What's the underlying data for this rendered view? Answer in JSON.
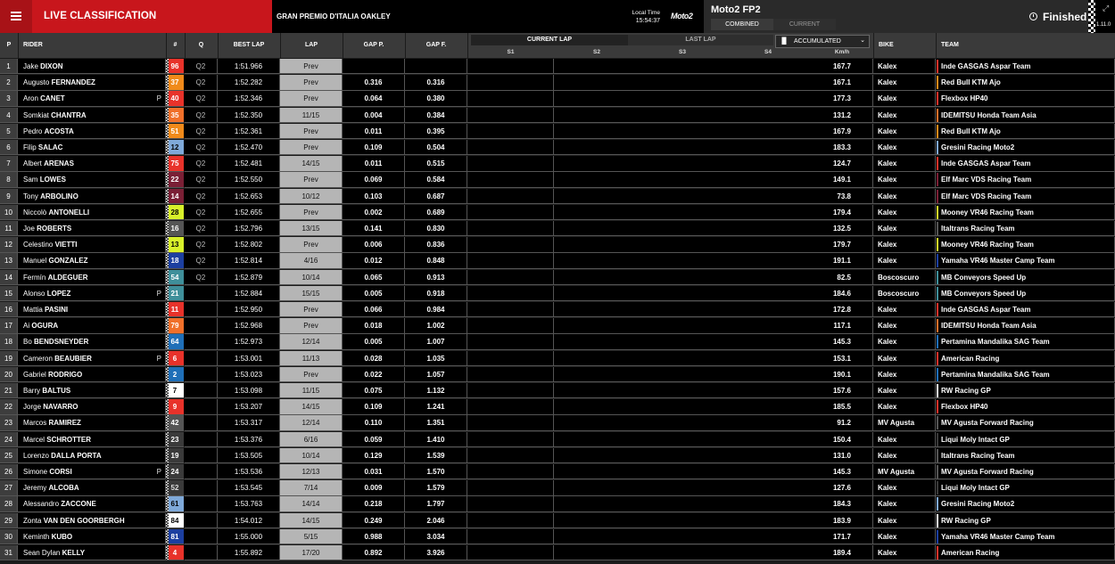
{
  "topbar": {
    "title": "LIVE CLASSIFICATION",
    "event": "GRAN PREMIO D'ITALIA OAKLEY",
    "local_time_label": "Local Time",
    "local_time": "15:54:37",
    "logo_text": "Moto2",
    "session": "Moto2 FP2",
    "tab_combined": "COMBINED",
    "tab_current": "CURRENT",
    "status": "Finished",
    "version": "1.11.0"
  },
  "headers": {
    "pos": "P",
    "rider": "RIDER",
    "num": "#",
    "q": "Q",
    "best": "BEST LAP",
    "lap": "LAP",
    "gapp": "GAP P.",
    "gapf": "GAP F.",
    "current_lap": "CURRENT LAP",
    "last_lap": "LAST LAP",
    "accumulated": "ACCUMULATED",
    "s1": "S1",
    "s2": "S2",
    "s3": "S3",
    "s4": "S4",
    "kmh": "Km/h",
    "bike": "BIKE",
    "team": "TEAM"
  },
  "rows": [
    {
      "pos": "1",
      "first": "Jake",
      "last": "DIXON",
      "pit": "",
      "num": "96",
      "num_bg": "#e8322a",
      "num_fg": "#fff",
      "q": "Q2",
      "best": "1:51.966",
      "lap": "Prev",
      "gapp": "",
      "gapf": "",
      "kmh": "167.7",
      "bike": "Kalex",
      "team": "Inde GASGAS Aspar Team",
      "team_color": "#e8322a"
    },
    {
      "pos": "2",
      "first": "Augusto",
      "last": "FERNANDEZ",
      "pit": "",
      "num": "37",
      "num_bg": "#f08a1a",
      "num_fg": "#fff",
      "q": "Q2",
      "best": "1:52.282",
      "lap": "Prev",
      "gapp": "0.316",
      "gapf": "0.316",
      "kmh": "167.1",
      "bike": "Kalex",
      "team": "Red Bull KTM Ajo",
      "team_color": "#f08a1a"
    },
    {
      "pos": "3",
      "first": "Aron",
      "last": "CANET",
      "pit": "P",
      "num": "40",
      "num_bg": "#e8322a",
      "num_fg": "#fff",
      "q": "Q2",
      "best": "1:52.346",
      "lap": "Prev",
      "gapp": "0.064",
      "gapf": "0.380",
      "kmh": "177.3",
      "bike": "Kalex",
      "team": "Flexbox HP40",
      "team_color": "#e8322a"
    },
    {
      "pos": "4",
      "first": "Somkiat",
      "last": "CHANTRA",
      "pit": "",
      "num": "35",
      "num_bg": "#f0702a",
      "num_fg": "#fff",
      "q": "Q2",
      "best": "1:52.350",
      "lap": "11/15",
      "gapp": "0.004",
      "gapf": "0.384",
      "kmh": "131.2",
      "bike": "Kalex",
      "team": "IDEMITSU Honda Team Asia",
      "team_color": "#f0702a"
    },
    {
      "pos": "5",
      "first": "Pedro",
      "last": "ACOSTA",
      "pit": "",
      "num": "51",
      "num_bg": "#f08a1a",
      "num_fg": "#fff",
      "q": "Q2",
      "best": "1:52.361",
      "lap": "Prev",
      "gapp": "0.011",
      "gapf": "0.395",
      "kmh": "167.9",
      "bike": "Kalex",
      "team": "Red Bull KTM Ajo",
      "team_color": "#f08a1a"
    },
    {
      "pos": "6",
      "first": "Filip",
      "last": "SALAC",
      "pit": "",
      "num": "12",
      "num_bg": "#7fa9d9",
      "num_fg": "#000",
      "q": "Q2",
      "best": "1:52.470",
      "lap": "Prev",
      "gapp": "0.109",
      "gapf": "0.504",
      "kmh": "183.3",
      "bike": "Kalex",
      "team": "Gresini Racing Moto2",
      "team_color": "#7fa9d9"
    },
    {
      "pos": "7",
      "first": "Albert",
      "last": "ARENAS",
      "pit": "",
      "num": "75",
      "num_bg": "#e8322a",
      "num_fg": "#fff",
      "q": "Q2",
      "best": "1:52.481",
      "lap": "14/15",
      "gapp": "0.011",
      "gapf": "0.515",
      "kmh": "124.7",
      "bike": "Kalex",
      "team": "Inde GASGAS Aspar Team",
      "team_color": "#e8322a"
    },
    {
      "pos": "8",
      "first": "Sam",
      "last": "LOWES",
      "pit": "",
      "num": "22",
      "num_bg": "#7a1f35",
      "num_fg": "#fff",
      "q": "Q2",
      "best": "1:52.550",
      "lap": "Prev",
      "gapp": "0.069",
      "gapf": "0.584",
      "kmh": "149.1",
      "bike": "Kalex",
      "team": "Elf Marc VDS Racing Team",
      "team_color": "#7a1f35"
    },
    {
      "pos": "9",
      "first": "Tony",
      "last": "ARBOLINO",
      "pit": "",
      "num": "14",
      "num_bg": "#7a1f35",
      "num_fg": "#fff",
      "q": "Q2",
      "best": "1:52.653",
      "lap": "10/12",
      "gapp": "0.103",
      "gapf": "0.687",
      "kmh": "73.8",
      "bike": "Kalex",
      "team": "Elf Marc VDS Racing Team",
      "team_color": "#7a1f35"
    },
    {
      "pos": "10",
      "first": "Niccolò",
      "last": "ANTONELLI",
      "pit": "",
      "num": "28",
      "num_bg": "#d8f02a",
      "num_fg": "#000",
      "q": "Q2",
      "best": "1:52.655",
      "lap": "Prev",
      "gapp": "0.002",
      "gapf": "0.689",
      "kmh": "179.4",
      "bike": "Kalex",
      "team": "Mooney VR46 Racing Team",
      "team_color": "#d8f02a"
    },
    {
      "pos": "11",
      "first": "Joe",
      "last": "ROBERTS",
      "pit": "",
      "num": "16",
      "num_bg": "#555",
      "num_fg": "#fff",
      "q": "Q2",
      "best": "1:52.796",
      "lap": "13/15",
      "gapp": "0.141",
      "gapf": "0.830",
      "kmh": "132.5",
      "bike": "Kalex",
      "team": "Italtrans Racing Team",
      "team_color": "#555"
    },
    {
      "pos": "12",
      "first": "Celestino",
      "last": "VIETTI",
      "pit": "",
      "num": "13",
      "num_bg": "#d8f02a",
      "num_fg": "#000",
      "q": "Q2",
      "best": "1:52.802",
      "lap": "Prev",
      "gapp": "0.006",
      "gapf": "0.836",
      "kmh": "179.7",
      "bike": "Kalex",
      "team": "Mooney VR46 Racing Team",
      "team_color": "#d8f02a"
    },
    {
      "pos": "13",
      "first": "Manuel",
      "last": "GONZALEZ",
      "pit": "",
      "num": "18",
      "num_bg": "#1c3fa0",
      "num_fg": "#fff",
      "q": "Q2",
      "best": "1:52.814",
      "lap": "4/16",
      "gapp": "0.012",
      "gapf": "0.848",
      "kmh": "191.1",
      "bike": "Kalex",
      "team": "Yamaha VR46 Master Camp Team",
      "team_color": "#1c3fa0"
    },
    {
      "pos": "14",
      "first": "Fermín",
      "last": "ALDEGUER",
      "pit": "",
      "num": "54",
      "num_bg": "#3f8f9a",
      "num_fg": "#fff",
      "q": "Q2",
      "best": "1:52.879",
      "lap": "10/14",
      "gapp": "0.065",
      "gapf": "0.913",
      "kmh": "82.5",
      "bike": "Boscoscuro",
      "team": "MB Conveyors Speed Up",
      "team_color": "#3f8f9a"
    },
    {
      "pos": "15",
      "first": "Alonso",
      "last": "LOPEZ",
      "pit": "P",
      "num": "21",
      "num_bg": "#3f8f9a",
      "num_fg": "#fff",
      "q": "",
      "best": "1:52.884",
      "lap": "15/15",
      "gapp": "0.005",
      "gapf": "0.918",
      "kmh": "184.6",
      "bike": "Boscoscuro",
      "team": "MB Conveyors Speed Up",
      "team_color": "#3f8f9a"
    },
    {
      "pos": "16",
      "first": "Mattia",
      "last": "PASINI",
      "pit": "",
      "num": "11",
      "num_bg": "#e8322a",
      "num_fg": "#fff",
      "q": "",
      "best": "1:52.950",
      "lap": "Prev",
      "gapp": "0.066",
      "gapf": "0.984",
      "kmh": "172.8",
      "bike": "Kalex",
      "team": "Inde GASGAS Aspar Team",
      "team_color": "#e8322a"
    },
    {
      "pos": "17",
      "first": "Ai",
      "last": "OGURA",
      "pit": "",
      "num": "79",
      "num_bg": "#f0702a",
      "num_fg": "#fff",
      "q": "",
      "best": "1:52.968",
      "lap": "Prev",
      "gapp": "0.018",
      "gapf": "1.002",
      "kmh": "117.1",
      "bike": "Kalex",
      "team": "IDEMITSU Honda Team Asia",
      "team_color": "#f0702a"
    },
    {
      "pos": "18",
      "first": "Bo",
      "last": "BENDSNEYDER",
      "pit": "",
      "num": "64",
      "num_bg": "#1f6fb8",
      "num_fg": "#fff",
      "q": "",
      "best": "1:52.973",
      "lap": "12/14",
      "gapp": "0.005",
      "gapf": "1.007",
      "kmh": "145.3",
      "bike": "Kalex",
      "team": "Pertamina Mandalika SAG Team",
      "team_color": "#1f6fb8"
    },
    {
      "pos": "19",
      "first": "Cameron",
      "last": "BEAUBIER",
      "pit": "P",
      "num": "6",
      "num_bg": "#e8322a",
      "num_fg": "#fff",
      "q": "",
      "best": "1:53.001",
      "lap": "11/13",
      "gapp": "0.028",
      "gapf": "1.035",
      "kmh": "153.1",
      "bike": "Kalex",
      "team": "American Racing",
      "team_color": "#e8322a"
    },
    {
      "pos": "20",
      "first": "Gabriel",
      "last": "RODRIGO",
      "pit": "",
      "num": "2",
      "num_bg": "#1f6fb8",
      "num_fg": "#fff",
      "q": "",
      "best": "1:53.023",
      "lap": "Prev",
      "gapp": "0.022",
      "gapf": "1.057",
      "kmh": "190.1",
      "bike": "Kalex",
      "team": "Pertamina Mandalika SAG Team",
      "team_color": "#1f6fb8"
    },
    {
      "pos": "21",
      "first": "Barry",
      "last": "BALTUS",
      "pit": "",
      "num": "7",
      "num_bg": "#ffffff",
      "num_fg": "#000",
      "q": "",
      "best": "1:53.098",
      "lap": "11/15",
      "gapp": "0.075",
      "gapf": "1.132",
      "kmh": "157.6",
      "bike": "Kalex",
      "team": "RW Racing GP",
      "team_color": "#ffffff"
    },
    {
      "pos": "22",
      "first": "Jorge",
      "last": "NAVARRO",
      "pit": "",
      "num": "9",
      "num_bg": "#e8322a",
      "num_fg": "#fff",
      "q": "",
      "best": "1:53.207",
      "lap": "14/15",
      "gapp": "0.109",
      "gapf": "1.241",
      "kmh": "185.5",
      "bike": "Kalex",
      "team": "Flexbox HP40",
      "team_color": "#e8322a"
    },
    {
      "pos": "23",
      "first": "Marcos",
      "last": "RAMIREZ",
      "pit": "",
      "num": "42",
      "num_bg": "#555",
      "num_fg": "#fff",
      "q": "",
      "best": "1:53.317",
      "lap": "12/14",
      "gapp": "0.110",
      "gapf": "1.351",
      "kmh": "91.2",
      "bike": "MV Agusta",
      "team": "MV Agusta Forward Racing",
      "team_color": "#555"
    },
    {
      "pos": "24",
      "first": "Marcel",
      "last": "SCHROTTER",
      "pit": "",
      "num": "23",
      "num_bg": "#3a3a3a",
      "num_fg": "#fff",
      "q": "",
      "best": "1:53.376",
      "lap": "6/16",
      "gapp": "0.059",
      "gapf": "1.410",
      "kmh": "150.4",
      "bike": "Kalex",
      "team": "Liqui Moly Intact GP",
      "team_color": "#3a3a3a"
    },
    {
      "pos": "25",
      "first": "Lorenzo",
      "last": "DALLA PORTA",
      "pit": "",
      "num": "19",
      "num_bg": "#3a3a3a",
      "num_fg": "#fff",
      "q": "",
      "best": "1:53.505",
      "lap": "10/14",
      "gapp": "0.129",
      "gapf": "1.539",
      "kmh": "131.0",
      "bike": "Kalex",
      "team": "Italtrans Racing Team",
      "team_color": "#555"
    },
    {
      "pos": "26",
      "first": "Simone",
      "last": "CORSI",
      "pit": "P",
      "num": "24",
      "num_bg": "#3a3a3a",
      "num_fg": "#fff",
      "q": "",
      "best": "1:53.536",
      "lap": "12/13",
      "gapp": "0.031",
      "gapf": "1.570",
      "kmh": "145.3",
      "bike": "MV Agusta",
      "team": "MV Agusta Forward Racing",
      "team_color": "#555"
    },
    {
      "pos": "27",
      "first": "Jeremy",
      "last": "ALCOBA",
      "pit": "",
      "num": "52",
      "num_bg": "#3a3a3a",
      "num_fg": "#ddd",
      "q": "",
      "best": "1:53.545",
      "lap": "7/14",
      "gapp": "0.009",
      "gapf": "1.579",
      "kmh": "127.6",
      "bike": "Kalex",
      "team": "Liqui Moly Intact GP",
      "team_color": "#3a3a3a"
    },
    {
      "pos": "28",
      "first": "Alessandro",
      "last": "ZACCONE",
      "pit": "",
      "num": "61",
      "num_bg": "#7fa9d9",
      "num_fg": "#000",
      "q": "",
      "best": "1:53.763",
      "lap": "14/14",
      "gapp": "0.218",
      "gapf": "1.797",
      "kmh": "184.3",
      "bike": "Kalex",
      "team": "Gresini Racing Moto2",
      "team_color": "#7fa9d9"
    },
    {
      "pos": "29",
      "first": "Zonta",
      "last": "VAN DEN GOORBERGH",
      "pit": "",
      "num": "84",
      "num_bg": "#ffffff",
      "num_fg": "#000",
      "q": "",
      "best": "1:54.012",
      "lap": "14/15",
      "gapp": "0.249",
      "gapf": "2.046",
      "kmh": "183.9",
      "bike": "Kalex",
      "team": "RW Racing GP",
      "team_color": "#ffffff"
    },
    {
      "pos": "30",
      "first": "Keminth",
      "last": "KUBO",
      "pit": "",
      "num": "81",
      "num_bg": "#1c3fa0",
      "num_fg": "#fff",
      "q": "",
      "best": "1:55.000",
      "lap": "5/15",
      "gapp": "0.988",
      "gapf": "3.034",
      "kmh": "171.7",
      "bike": "Kalex",
      "team": "Yamaha VR46 Master Camp Team",
      "team_color": "#1c3fa0"
    },
    {
      "pos": "31",
      "first": "Sean Dylan",
      "last": "KELLY",
      "pit": "",
      "num": "4",
      "num_bg": "#e8322a",
      "num_fg": "#fff",
      "q": "",
      "best": "1:55.892",
      "lap": "17/20",
      "gapp": "0.892",
      "gapf": "3.926",
      "kmh": "189.4",
      "bike": "Kalex",
      "team": "American Racing",
      "team_color": "#e8322a"
    }
  ]
}
